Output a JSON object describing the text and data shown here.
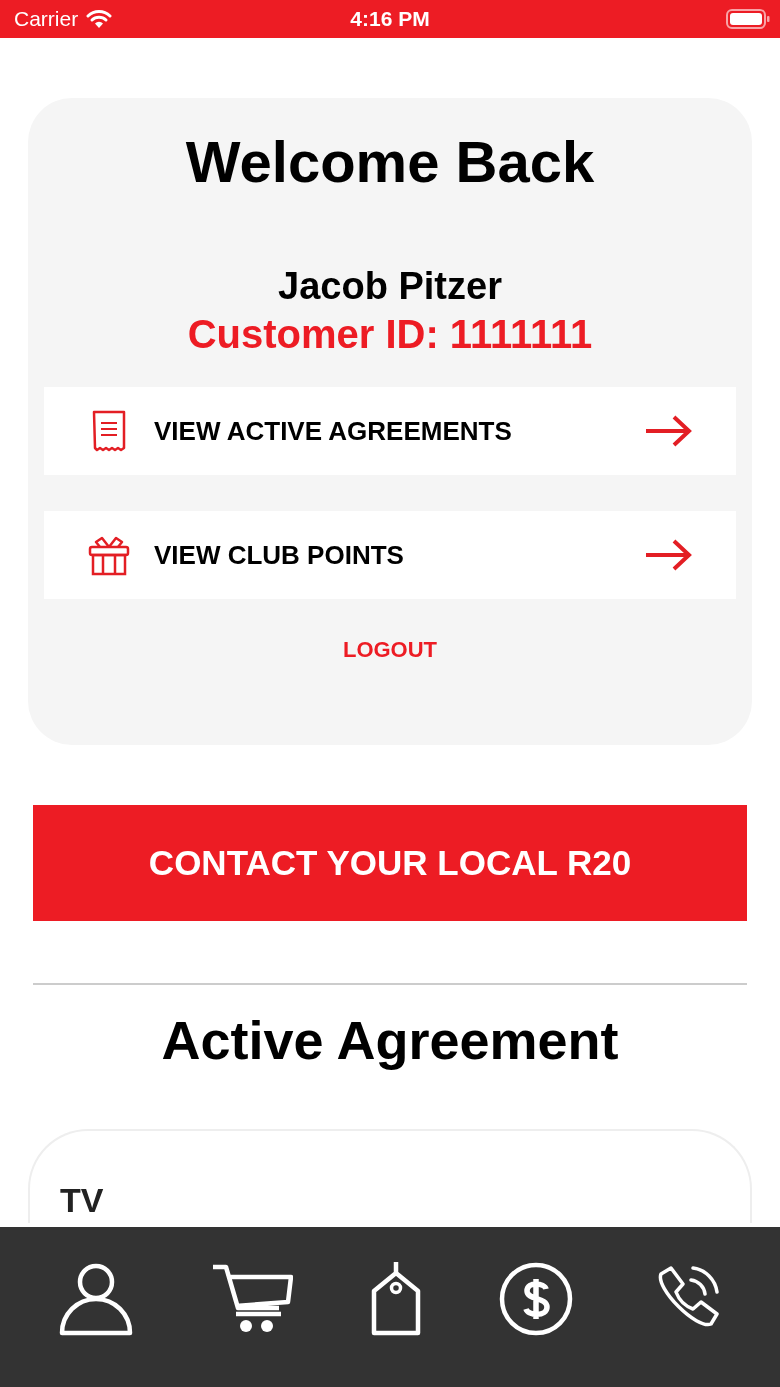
{
  "status_bar": {
    "carrier": "Carrier",
    "time": "4:16 PM"
  },
  "profile_card": {
    "title": "Welcome Back",
    "name": "Jacob Pitzer",
    "customer_id": "Customer ID: 1111111",
    "menu": [
      {
        "kind": "agreements",
        "label": "VIEW ACTIVE AGREEMENTS"
      },
      {
        "kind": "points",
        "label": "VIEW CLUB POINTS"
      }
    ],
    "logout": "LOGOUT"
  },
  "contact_button": "CONTACT YOUR LOCAL R20",
  "section_title": "Active Agreement",
  "agreements": [
    {
      "title": "TV"
    }
  ],
  "tab_bar": [
    {
      "kind": "profile"
    },
    {
      "kind": "cart"
    },
    {
      "kind": "tag"
    },
    {
      "kind": "payments"
    },
    {
      "kind": "call"
    }
  ]
}
